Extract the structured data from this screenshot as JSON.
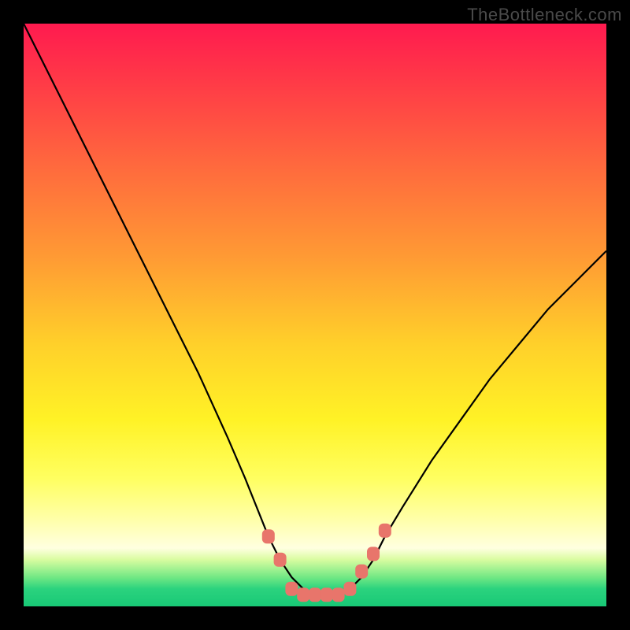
{
  "attribution": "TheBottleneck.com",
  "colors": {
    "frame": "#000000",
    "gradient_top": "#ff1a4f",
    "gradient_mid": "#fff226",
    "gradient_bottom": "#18c876",
    "curve": "#000000",
    "marker": "#e8756b"
  },
  "chart_data": {
    "type": "line",
    "title": "",
    "xlabel": "",
    "ylabel": "",
    "xlim": [
      0,
      100
    ],
    "ylim": [
      0,
      100
    ],
    "series": [
      {
        "name": "bottleneck-curve",
        "x": [
          0,
          5,
          10,
          15,
          20,
          25,
          30,
          35,
          38,
          40,
          42,
          44,
          46,
          48,
          50,
          52,
          54,
          56,
          58,
          60,
          62,
          65,
          70,
          75,
          80,
          85,
          90,
          95,
          100
        ],
        "y": [
          100,
          90,
          80,
          70,
          60,
          50,
          40,
          29,
          22,
          17,
          12,
          8,
          5,
          3,
          2,
          2,
          2,
          3,
          5,
          8,
          12,
          17,
          25,
          32,
          39,
          45,
          51,
          56,
          61
        ]
      }
    ],
    "markers": [
      {
        "x": 42,
        "y": 12
      },
      {
        "x": 44,
        "y": 8
      },
      {
        "x": 46,
        "y": 3
      },
      {
        "x": 48,
        "y": 2
      },
      {
        "x": 50,
        "y": 2
      },
      {
        "x": 52,
        "y": 2
      },
      {
        "x": 54,
        "y": 2
      },
      {
        "x": 56,
        "y": 3
      },
      {
        "x": 58,
        "y": 6
      },
      {
        "x": 60,
        "y": 9
      },
      {
        "x": 62,
        "y": 13
      }
    ]
  }
}
